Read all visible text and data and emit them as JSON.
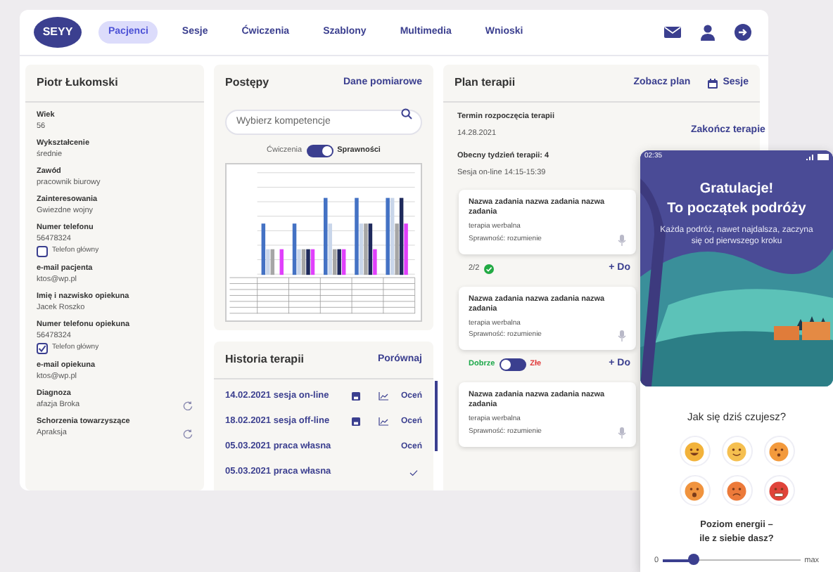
{
  "nav": {
    "logo": "SEYY",
    "tabs": [
      {
        "label": "Pacjenci",
        "selected": true
      },
      {
        "label": "Sesje",
        "selected": false
      },
      {
        "label": "Ćwiczenia",
        "selected": false
      },
      {
        "label": "Szablony",
        "selected": false
      },
      {
        "label": "Multimedia",
        "selected": false
      },
      {
        "label": "Wnioski",
        "selected": false
      }
    ]
  },
  "patient": {
    "name": "Piotr Łukomski",
    "fields": [
      {
        "kind": "text",
        "label": "Wiek",
        "value": "56"
      },
      {
        "kind": "text",
        "label": "Wykształcenie",
        "value": "średnie"
      },
      {
        "kind": "text",
        "label": "Zawód",
        "value": "pracownik biurowy"
      },
      {
        "kind": "text",
        "label": "Zainteresowania",
        "value": "Gwiezdne wojny"
      },
      {
        "kind": "phone",
        "label": "Numer telefonu",
        "value": "56478324",
        "checkbox": {
          "label": "Telefon główny",
          "checked": false
        }
      },
      {
        "kind": "text",
        "label": "e-mail pacjenta",
        "value": "ktos@wp.pl"
      },
      {
        "kind": "text",
        "label": "Imię i nazwisko opiekuna",
        "value": "Jacek Roszko"
      },
      {
        "kind": "phone",
        "label": "Numer telefonu opiekuna",
        "value": "56478324",
        "checkbox": {
          "label": "Telefon główny",
          "checked": true
        }
      },
      {
        "kind": "text",
        "label": "e-mail opiekuna",
        "value": "ktos@wp.pl"
      },
      {
        "kind": "refresh",
        "label": "Diagnoza",
        "value": "afazja Broka"
      },
      {
        "kind": "refresh",
        "label": "Schorzenia towarzyszące",
        "value": "Apraksja"
      }
    ]
  },
  "progress": {
    "title": "Postępy",
    "link": "Dane pomiarowe",
    "search": {
      "placeholder": "Wybierz kompetencje"
    },
    "toggle": {
      "left": "Ćwiczenia",
      "right": "Sprawności",
      "on": true
    }
  },
  "history": {
    "title": "Historia terapii",
    "link": "Porównaj",
    "rows": [
      {
        "text": "14.02.2021 sesja on-line",
        "kind": "session",
        "action": "Oceń"
      },
      {
        "text": "18.02.2021 sesja off-line",
        "kind": "session",
        "action": "Oceń"
      },
      {
        "text": "05.03.2021 praca własna",
        "kind": "own",
        "action": "Oceń"
      },
      {
        "text": "05.03.2021 praca własna",
        "kind": "done"
      }
    ]
  },
  "plan": {
    "title": "Plan terapii",
    "link": "Zobacz plan",
    "sessions": "Sesje",
    "start_label": "Termin rozpoczęcia terapii",
    "start_value": "14.28.2021",
    "end_link": "Zakończ terapie",
    "week": "Obecny tydzień terapii: 4",
    "session": "Sesja on-line 14:15-15:39",
    "tasks": [
      {
        "title": "Nazwa zadania nazwa zadania nazwa zadania",
        "type": "terapia werbalna",
        "skill": "Sprawność: rozumienie",
        "footer": {
          "kind": "count",
          "count": "2/2",
          "add": "+ Do"
        }
      },
      {
        "title": "Nazwa zadania nazwa zadania nazwa zadania",
        "type": "terapia werbalna",
        "skill": "Sprawność: rozumienie",
        "footer": {
          "kind": "toggle",
          "good": "Dobrze",
          "bad": "Złe",
          "on": false,
          "add": "+ Do"
        }
      },
      {
        "title": "Nazwa zadania nazwa zadania nazwa zadania",
        "type": "terapia werbalna",
        "skill": "Sprawność: rozumienie"
      }
    ]
  },
  "phone": {
    "time": "02:35",
    "title": [
      "Gratulacje!",
      "To początek podróży"
    ],
    "subtitle": "Każda podróż, nawet najdalsza, zaczyna się od pierwszego kroku",
    "question": "Jak się dziś czujesz?",
    "moods": [
      {
        "kind": "laugh"
      },
      {
        "kind": "smile"
      },
      {
        "kind": "surprised"
      },
      {
        "kind": "shocked"
      },
      {
        "kind": "sad"
      },
      {
        "kind": "angry"
      }
    ],
    "energy": [
      "Poziom energii –",
      "ile z siebie dasz?"
    ],
    "slider": {
      "min": "0",
      "max": "max",
      "level": 0.22
    }
  }
}
